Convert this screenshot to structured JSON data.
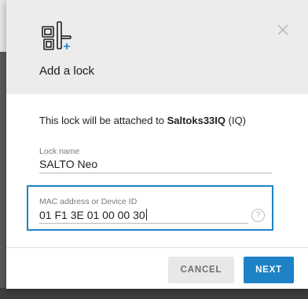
{
  "dialog": {
    "title": "Add a lock",
    "close_icon": "close-icon",
    "header_icon": "lock-add-icon"
  },
  "info": {
    "prefix": "This lock will be attached to ",
    "site_name": "Saltoks33IQ",
    "suffix": " (IQ)"
  },
  "lock_name": {
    "label": "Lock name",
    "value": "SALTO Neo"
  },
  "mac": {
    "label": "MAC address or Device ID",
    "value": "01 F1 3E 01 00 00 30",
    "help_icon": "help-icon",
    "help_glyph": "?"
  },
  "buttons": {
    "cancel": "CANCEL",
    "next": "NEXT"
  },
  "colors": {
    "accent": "#1d82c6",
    "header_bg": "#ececec"
  }
}
